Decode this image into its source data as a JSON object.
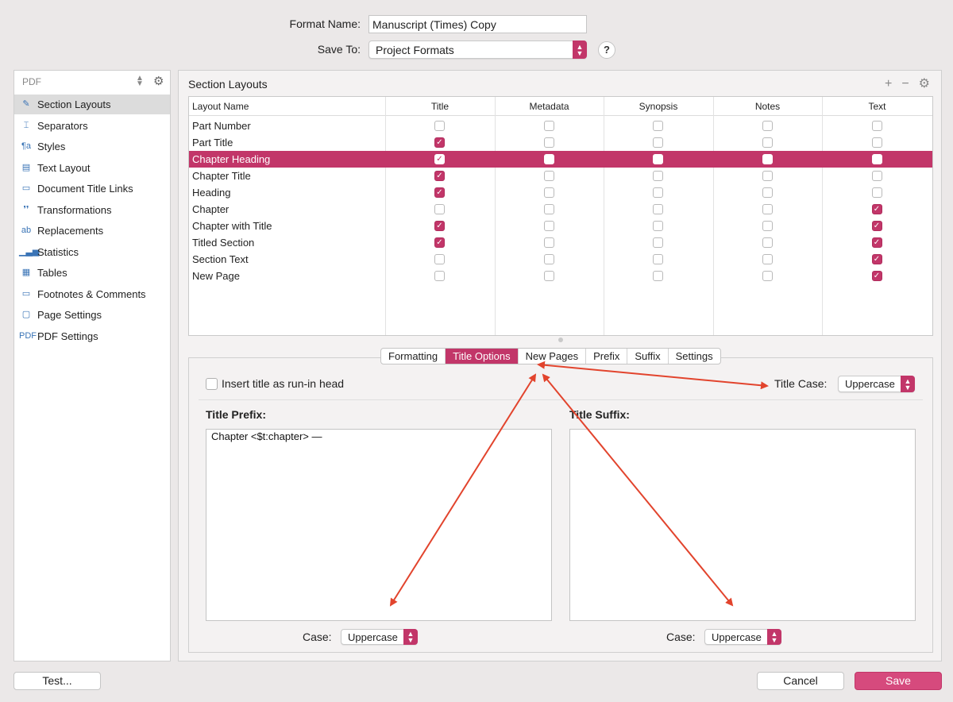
{
  "header": {
    "format_name_label": "Format Name:",
    "format_name_value": "Manuscript (Times) Copy",
    "save_to_label": "Save To:",
    "save_to_value": "Project Formats",
    "help_label": "?"
  },
  "sidebar": {
    "selector": "PDF",
    "items": [
      {
        "label": "Section Layouts",
        "icon": "paintbrush-icon",
        "glyph": "✎"
      },
      {
        "label": "Separators",
        "icon": "separator-icon",
        "glyph": "⌶"
      },
      {
        "label": "Styles",
        "icon": "paragraph-icon",
        "glyph": "¶a"
      },
      {
        "label": "Text Layout",
        "icon": "page-icon",
        "glyph": "▤"
      },
      {
        "label": "Document Title Links",
        "icon": "document-icon",
        "glyph": "▭"
      },
      {
        "label": "Transformations",
        "icon": "quotes-icon",
        "glyph": "❜❜"
      },
      {
        "label": "Replacements",
        "icon": "replace-icon",
        "glyph": "ab"
      },
      {
        "label": "Statistics",
        "icon": "bar-chart-icon",
        "glyph": "▁▃▅"
      },
      {
        "label": "Tables",
        "icon": "table-icon",
        "glyph": "▦"
      },
      {
        "label": "Footnotes & Comments",
        "icon": "note-icon",
        "glyph": "▭"
      },
      {
        "label": "Page Settings",
        "icon": "page-settings-icon",
        "glyph": "▢"
      },
      {
        "label": "PDF Settings",
        "icon": "pdf-icon",
        "glyph": "PDF"
      }
    ]
  },
  "main": {
    "title": "Section Layouts",
    "table": {
      "columns": [
        "Layout Name",
        "Title",
        "Metadata",
        "Synopsis",
        "Notes",
        "Text"
      ],
      "rows": [
        {
          "name": "Part Number",
          "checks": [
            false,
            false,
            false,
            false,
            false
          ]
        },
        {
          "name": "Part Title",
          "checks": [
            true,
            false,
            false,
            false,
            false
          ]
        },
        {
          "name": "Chapter Heading",
          "checks": [
            true,
            false,
            false,
            false,
            false
          ]
        },
        {
          "name": "Chapter Title",
          "checks": [
            true,
            false,
            false,
            false,
            false
          ]
        },
        {
          "name": "Heading",
          "checks": [
            true,
            false,
            false,
            false,
            false
          ]
        },
        {
          "name": "Chapter",
          "checks": [
            false,
            false,
            false,
            false,
            true
          ]
        },
        {
          "name": "Chapter with Title",
          "checks": [
            true,
            false,
            false,
            false,
            true
          ]
        },
        {
          "name": "Titled Section",
          "checks": [
            true,
            false,
            false,
            false,
            true
          ]
        },
        {
          "name": "Section Text",
          "checks": [
            false,
            false,
            false,
            false,
            true
          ]
        },
        {
          "name": "New Page",
          "checks": [
            false,
            false,
            false,
            false,
            true
          ]
        }
      ],
      "selected_row": 2
    },
    "tabs": [
      "Formatting",
      "Title Options",
      "New Pages",
      "Prefix",
      "Suffix",
      "Settings"
    ],
    "active_tab": 1,
    "title_options": {
      "run_in_label": "Insert title as run-in head",
      "title_case_label": "Title Case:",
      "title_case_value": "Uppercase",
      "prefix_label": "Title Prefix:",
      "prefix_value": "Chapter <$t:chapter> —",
      "suffix_label": "Title Suffix:",
      "suffix_value": "",
      "case_label": "Case:",
      "prefix_case_value": "Uppercase",
      "suffix_case_value": "Uppercase"
    }
  },
  "footer": {
    "test_label": "Test...",
    "cancel_label": "Cancel",
    "save_label": "Save"
  },
  "colors": {
    "accent": "#c23669",
    "annotation_arrow": "#e2442d"
  }
}
